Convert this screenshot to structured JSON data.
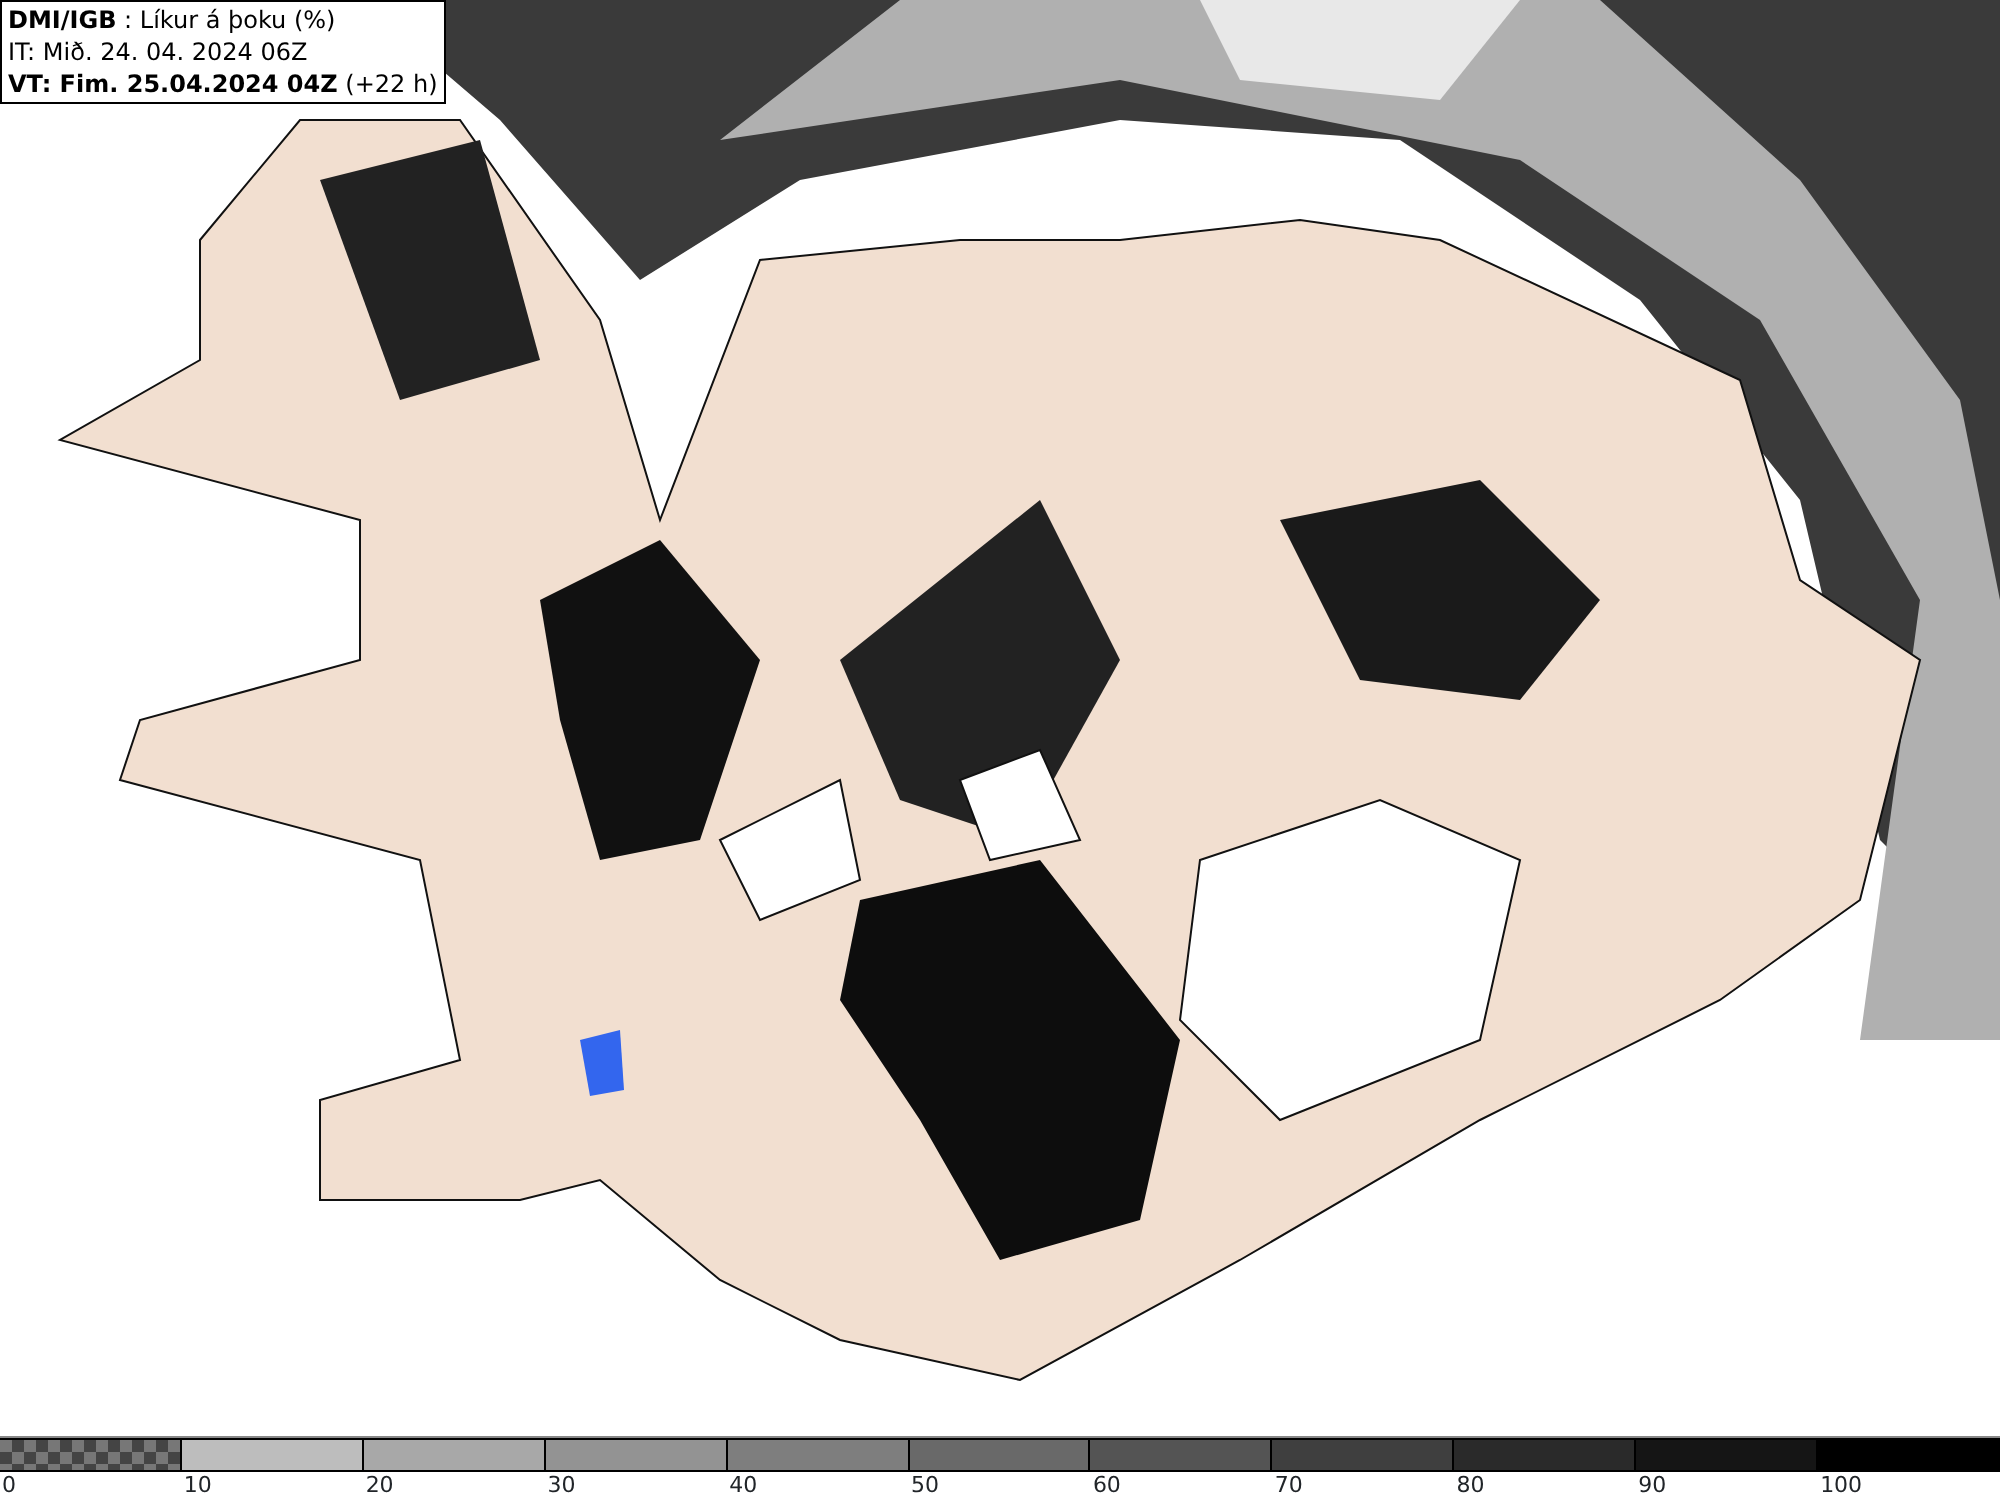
{
  "header": {
    "lines": [
      "**DMI/IGB** : Líkur á þoku (%)",
      "IT: Mið. 24. 04. 2024 06Z",
      "**VT: Fim. 25.04.2024 04Z** (+22 h)"
    ]
  },
  "legend": [
    {
      "kind": "checkered",
      "color": "#777777",
      "label": "0"
    },
    {
      "kind": "solid",
      "color": "#bdbdbd",
      "label": "10"
    },
    {
      "kind": "solid",
      "color": "#a8a8a8",
      "label": "20"
    },
    {
      "kind": "solid",
      "color": "#939393",
      "label": "30"
    },
    {
      "kind": "solid",
      "color": "#7e7e7e",
      "label": "40"
    },
    {
      "kind": "solid",
      "color": "#696969",
      "label": "50"
    },
    {
      "kind": "solid",
      "color": "#545454",
      "label": "60"
    },
    {
      "kind": "solid",
      "color": "#3f3f3f",
      "label": "70"
    },
    {
      "kind": "solid",
      "color": "#2a2a2a",
      "label": "80"
    },
    {
      "kind": "solid",
      "color": "#151515",
      "label": "90"
    },
    {
      "kind": "solid",
      "color": "#000000",
      "label": "100"
    }
  ]
}
